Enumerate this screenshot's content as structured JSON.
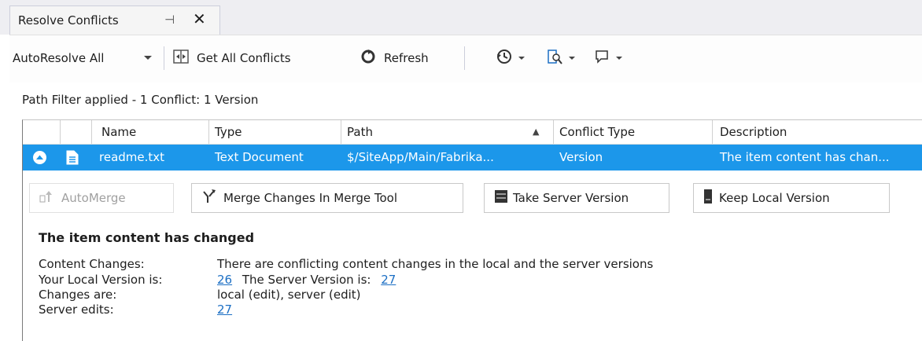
{
  "tab": {
    "title": "Resolve Conflicts",
    "pin_glyph": "⊣",
    "close_glyph": "✕"
  },
  "toolbar": {
    "autoresolve_label": "AutoResolve All",
    "get_all_label": "Get All Conflicts",
    "refresh_label": "Refresh"
  },
  "status_text": "Path Filter applied - 1 Conflict: 1 Version",
  "columns": [
    "Name",
    "Type",
    "Path",
    "Conflict Type",
    "Description"
  ],
  "sort_indicator": "▲",
  "row": {
    "name": "readme.txt",
    "type": "Text Document",
    "path": "$/SiteApp/Main/Fabrika...",
    "conflict_type": "Version",
    "description": "The item content has chan..."
  },
  "actions": {
    "automerge": "AutoMerge",
    "merge_tool": "Merge Changes In Merge Tool",
    "take_server": "Take Server Version",
    "keep_local": "Keep Local Version"
  },
  "details": {
    "heading": "The item content has changed",
    "content_changes_label": "Content Changes:",
    "content_changes_value": "There are conflicting content changes in the local and the server versions",
    "local_version_label": "Your Local Version is:",
    "local_version": "26",
    "server_version_label": "The Server Version is:",
    "server_version": "27",
    "changes_are_label": "Changes are:",
    "changes_are_value": "local (edit), server (edit)",
    "server_edits_label": "Server edits:",
    "server_edits_value": "27"
  },
  "colors": {
    "selection": "#1c97ea",
    "link": "#1c6fc4",
    "tabstrip": "#eeeef2"
  }
}
